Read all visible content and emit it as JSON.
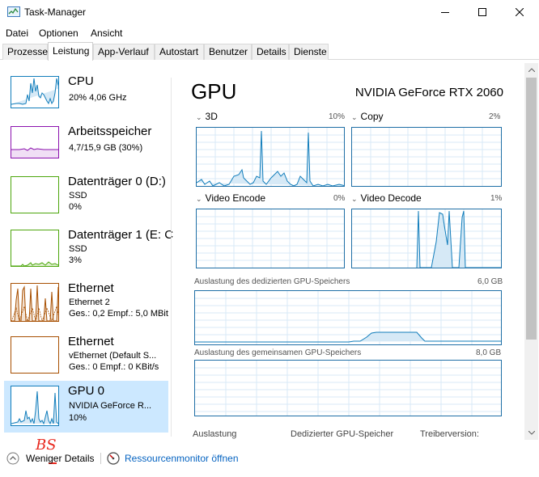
{
  "window": {
    "title": "Task-Manager"
  },
  "menu": [
    "Datei",
    "Optionen",
    "Ansicht"
  ],
  "tabs": [
    "Prozesse",
    "Leistung",
    "App-Verlauf",
    "Autostart",
    "Benutzer",
    "Details",
    "Dienste"
  ],
  "sidebar": {
    "items": [
      {
        "title": "CPU",
        "line1": "20%  4,06 GHz",
        "line2": "",
        "color": "#117dbb"
      },
      {
        "title": "Arbeitsspeicher",
        "line1": "4,7/15,9 GB (30%)",
        "line2": "",
        "color": "#8b12ae"
      },
      {
        "title": "Datenträger 0 (D:)",
        "line1": "SSD",
        "line2": "0%",
        "color": "#4da60c"
      },
      {
        "title": "Datenträger 1 (E: C",
        "line1": "SSD",
        "line2": "3%",
        "color": "#4da60c"
      },
      {
        "title": "Ethernet",
        "line1": "Ethernet 2",
        "line2": "Ges.: 0,2  Empf.: 5,0 MBit",
        "color": "#a74f01"
      },
      {
        "title": "Ethernet",
        "line1": "vEthernet (Default S...",
        "line2": "Ges.: 0  Empf.: 0 KBit/s",
        "color": "#a74f01"
      },
      {
        "title": "GPU 0",
        "line1": "NVIDIA GeForce R...",
        "line2": "10%",
        "color": "#117dbb"
      }
    ]
  },
  "main": {
    "title": "GPU",
    "gpu_name": "NVIDIA GeForce RTX 2060",
    "engines": [
      {
        "label": "3D",
        "percent": "10%"
      },
      {
        "label": "Copy",
        "percent": "2%"
      },
      {
        "label": "Video Encode",
        "percent": "0%"
      },
      {
        "label": "Video Decode",
        "percent": "1%"
      }
    ],
    "dedicated_memory": {
      "label": "Auslastung des dedizierten GPU-Speichers",
      "value": "6,0 GB"
    },
    "shared_memory": {
      "label": "Auslastung des gemeinsamen GPU-Speichers",
      "value": "8,0 GB"
    },
    "bottom_labels": [
      "Auslastung",
      "Dedizierter GPU-Speicher",
      "Treiberversion:"
    ]
  },
  "footer": {
    "fewer_details": "Weniger Details",
    "resource_monitor": "Ressourcenmonitor öffnen",
    "annotation": "BS"
  },
  "colors": {
    "gpu_line": "#117dbb",
    "selected_bg": "#cce8ff",
    "link": "#0563c1",
    "annotation": "#e8281e"
  }
}
